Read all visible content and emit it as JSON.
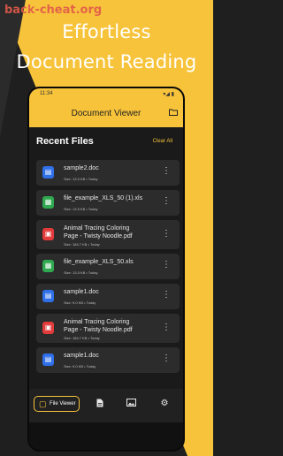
{
  "promo": {
    "watermark": "back-cheat.org",
    "headline_line1": "Effortless",
    "headline_line2": "Document Reading"
  },
  "status_bar": {
    "time": "11:34",
    "system": "▾◢ ▮"
  },
  "app_bar": {
    "title": "Document Viewer",
    "folder_icon": "folder-icon"
  },
  "recent": {
    "title": "Recent Files",
    "clear_label": "Clear All"
  },
  "files": [
    {
      "name": "sample2.doc",
      "meta": "Size: 13.0 KB • Today",
      "type": "doc",
      "color": "#2f6fe8"
    },
    {
      "name": "file_example_XLS_50 (1).xls",
      "meta": "Size: 13.5 KB • Today",
      "type": "xls",
      "color": "#2fa84f"
    },
    {
      "name": "Animal Tracing Coloring Page - Twisty Noodle.pdf",
      "name_l1": "Animal Tracing Coloring",
      "name_l2": "Page - Twisty Noodle.pdf",
      "meta": "Size: 184.7 KB • Today",
      "type": "pdf",
      "color": "#e23b3b"
    },
    {
      "name": "file_example_XLS_50.xls",
      "meta": "Size: 13.5 KB • Today",
      "type": "xls",
      "color": "#2fa84f"
    },
    {
      "name": "sample1.doc",
      "meta": "Size: 9.0 KB • Today",
      "type": "doc",
      "color": "#2f6fe8"
    },
    {
      "name": "Animal Tracing Coloring Page - Twisty Noodle.pdf",
      "name_l1": "Animal Tracing Coloring",
      "name_l2": "Page - Twisty Noodle.pdf",
      "meta": "Size: 184.7 KB • Today",
      "type": "pdf",
      "color": "#e23b3b"
    },
    {
      "name": "sample1.doc",
      "meta": "Size: 9.0 KB • Today",
      "type": "doc",
      "color": "#2f6fe8"
    }
  ],
  "bottom_nav": {
    "active_label": "File Viewer",
    "items": [
      "file-viewer",
      "document",
      "image",
      "settings"
    ]
  },
  "colors": {
    "accent": "#f7c33a",
    "card": "#2c2c2c",
    "background": "#1a1a1a"
  }
}
